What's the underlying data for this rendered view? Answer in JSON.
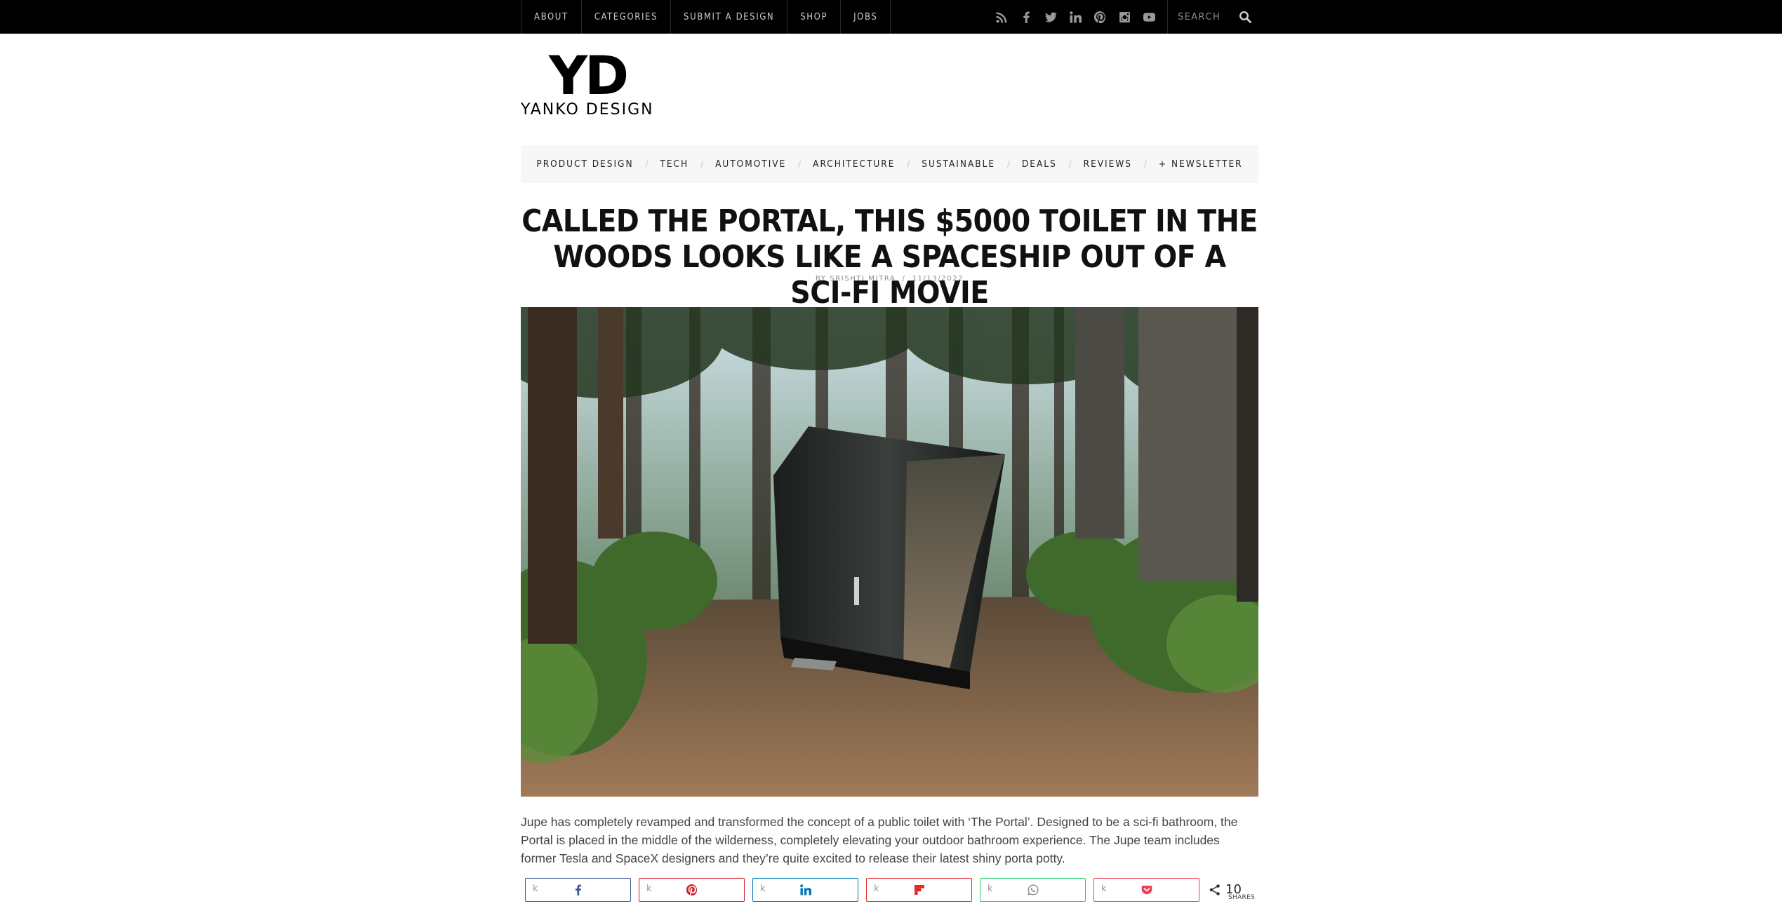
{
  "topnav": {
    "items": [
      "About",
      "Categories",
      "Submit a Design",
      "Shop",
      "Jobs"
    ],
    "social_icons": [
      "rss-icon",
      "facebook-icon",
      "twitter-icon",
      "linkedin-icon",
      "pinterest-icon",
      "instagram-icon",
      "youtube-icon"
    ],
    "search_placeholder": "SEARCH"
  },
  "logo": {
    "mark": "YD",
    "text": "YANKO DESIGN"
  },
  "catnav": {
    "items": [
      "Product Design",
      "Tech",
      "Automotive",
      "Architecture",
      "Sustainable",
      "Deals",
      "Reviews",
      "+ Newsletter"
    ]
  },
  "article": {
    "title": "Called the Portal, this $5000 toilet in the woods looks like a spaceship out of a sci-fi movie",
    "author": "by Srishti Mitra",
    "date": "11/13/2022",
    "body": "Jupe has completely revamped and transformed the concept of a public toilet with ‘The Portal’. Designed to be a sci-fi bathroom, the Portal is placed in the middle of the wilderness, completely elevating your outdoor bathroom experience. The Jupe team includes former Tesla and SpaceX designers and they’re quite excited to release their latest shiny porta potty."
  },
  "share": {
    "buttons": [
      {
        "key": "k",
        "icon": "facebook-icon",
        "color": "#3b5998"
      },
      {
        "key": "k",
        "icon": "pinterest-icon",
        "color": "#cb2027"
      },
      {
        "key": "k",
        "icon": "linkedin-icon",
        "color": "#0077b5"
      },
      {
        "key": "k",
        "icon": "flipboard-icon",
        "color": "#e12828"
      },
      {
        "key": "k",
        "icon": "whatsapp-icon",
        "color": "#25d366"
      },
      {
        "key": "k",
        "icon": "pocket-icon",
        "color": "#ee4056"
      }
    ],
    "count": "10",
    "count_label": "SHARES"
  }
}
